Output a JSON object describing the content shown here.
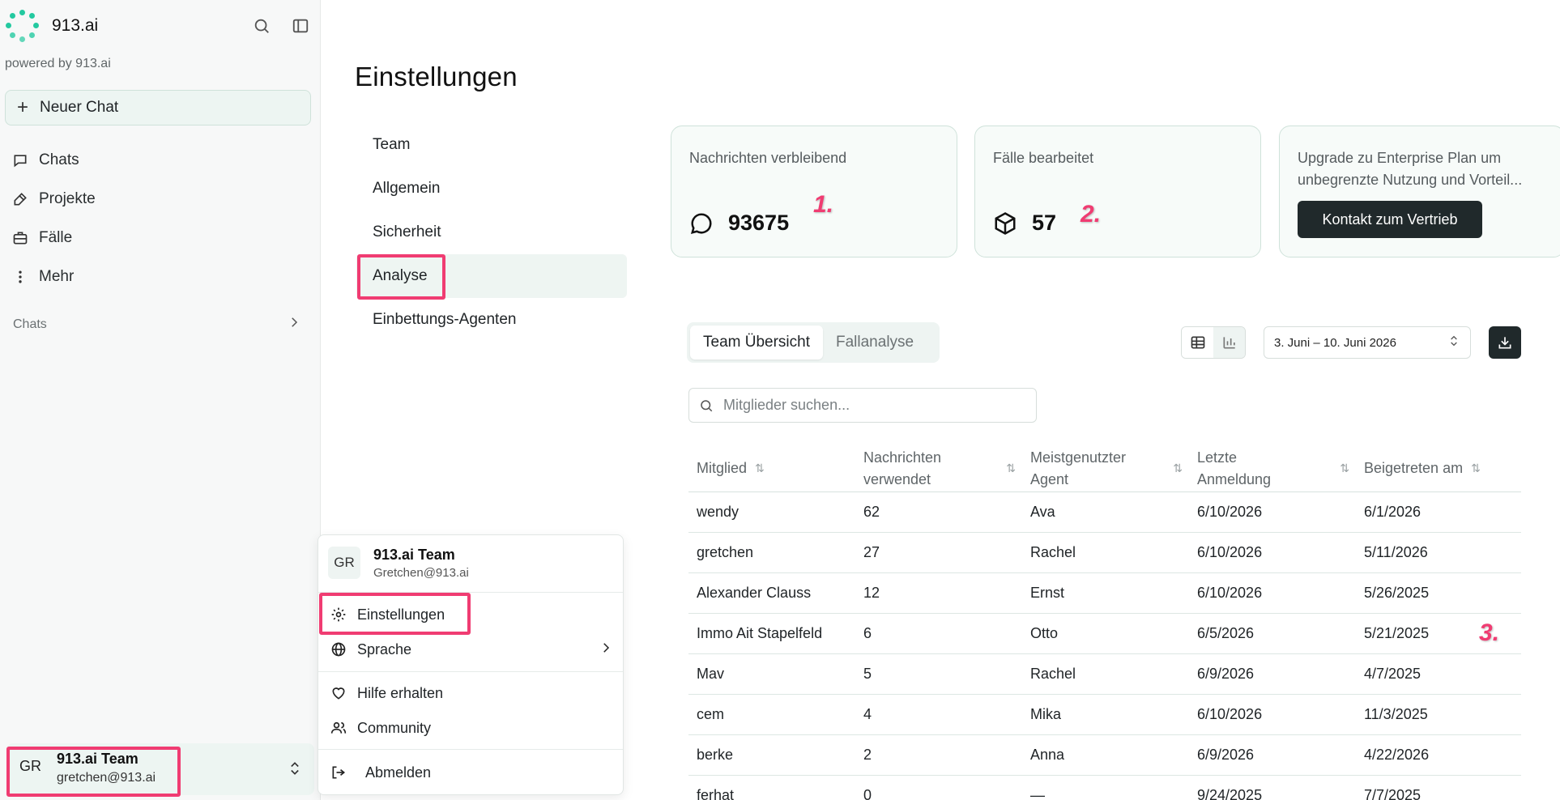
{
  "sidebar": {
    "brand": "913.ai",
    "powered_by": "powered by 913.ai",
    "new_chat": "Neuer Chat",
    "items": [
      {
        "label": "Chats",
        "icon": "chat-bubble-icon"
      },
      {
        "label": "Projekte",
        "icon": "tools-icon"
      },
      {
        "label": "Fälle",
        "icon": "briefcase-icon"
      },
      {
        "label": "Mehr",
        "icon": "more-vertical-icon"
      }
    ],
    "section_label": "Chats",
    "user": {
      "initials": "GR",
      "name": "913.ai Team",
      "email": "gretchen@913.ai"
    }
  },
  "main": {
    "title": "Einstellungen",
    "settings_nav": [
      "Team",
      "Allgemein",
      "Sicherheit",
      "Analyse",
      "Einbettungs-Agenten"
    ],
    "active_nav": "Analyse",
    "cards": {
      "messages": {
        "title": "Nachrichten verbleibend",
        "value": "93675",
        "marker": "1."
      },
      "cases": {
        "title": "Fälle bearbeitet",
        "value": "57",
        "marker": "2."
      },
      "upgrade": {
        "title": "Upgrade zu Enterprise Plan um unbegrenzte Nutzung und Vorteil...",
        "button": "Kontakt zum Vertrieb"
      }
    },
    "tabs": [
      "Team Übersicht",
      "Fallanalyse"
    ],
    "date_range": "3. Juni – 10. Juni 2026",
    "search_placeholder": "Mitglieder suchen...",
    "table": {
      "headers": [
        "Mitglied",
        "Nachrichten verwendet",
        "Meistgenutzter Agent",
        "Letzte Anmeldung",
        "Beigetreten am"
      ],
      "rows": [
        [
          "wendy",
          "62",
          "Ava",
          "6/10/2026",
          "6/1/2026"
        ],
        [
          "gretchen",
          "27",
          "Rachel",
          "6/10/2026",
          "5/11/2026"
        ],
        [
          "Alexander Clauss",
          "12",
          "Ernst",
          "6/10/2026",
          "5/26/2025"
        ],
        [
          "Immo Ait Stapelfeld",
          "6",
          "Otto",
          "6/5/2026",
          "5/21/2025"
        ],
        [
          "Mav",
          "5",
          "Rachel",
          "6/9/2026",
          "4/7/2025"
        ],
        [
          "cem",
          "4",
          "Mika",
          "6/10/2026",
          "11/3/2025"
        ],
        [
          "berke",
          "2",
          "Anna",
          "6/9/2026",
          "4/22/2026"
        ],
        [
          "ferhat",
          "0",
          "—",
          "9/24/2025",
          "7/7/2025"
        ]
      ]
    },
    "marker3": "3."
  },
  "menu": {
    "initials": "GR",
    "name": "913.ai Team",
    "email": "Gretchen@913.ai",
    "items": [
      "Einstellungen",
      "Sprache",
      "Hilfe erhalten",
      "Community",
      "Abmelden"
    ]
  },
  "colors": {
    "accent": "#24c9a0",
    "highlight": "#f03c72",
    "dark": "#20292b"
  }
}
